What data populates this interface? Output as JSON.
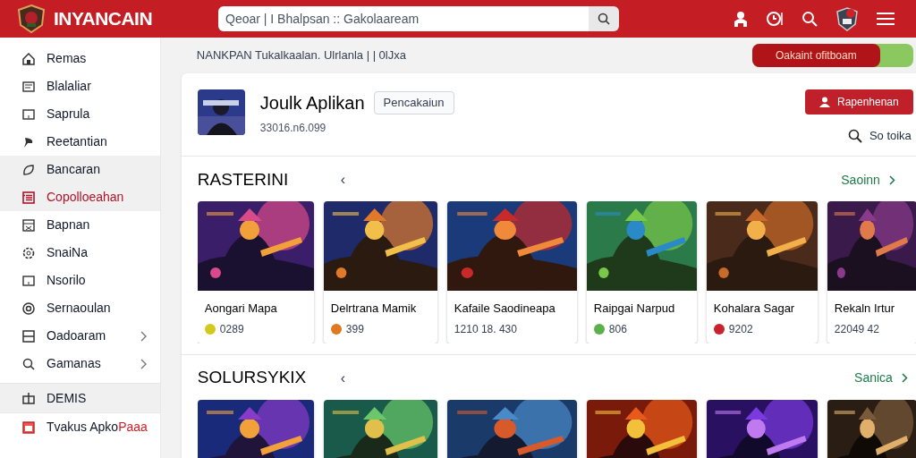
{
  "header": {
    "brand": "INYANCAIN",
    "search": {
      "placeholder": "Qeoar | I Bhalpsan :: Gakolaaream"
    }
  },
  "sidebar": {
    "items": [
      {
        "label": "Remas",
        "kind": "item",
        "selected": false,
        "highlighted": false
      },
      {
        "label": "Blalaliar",
        "kind": "item",
        "selected": false,
        "highlighted": false
      },
      {
        "label": "Saprula",
        "kind": "item",
        "selected": false,
        "highlighted": false
      },
      {
        "label": "Reetantian",
        "kind": "item",
        "selected": false,
        "highlighted": false
      },
      {
        "label": "Bancaran",
        "kind": "item",
        "selected": false,
        "highlighted": true
      },
      {
        "label": "Copolloeahan",
        "kind": "item",
        "selected": true,
        "highlighted": true
      },
      {
        "label": "Bapnan",
        "kind": "item",
        "selected": false,
        "highlighted": false
      },
      {
        "label": "SnaiNa",
        "kind": "item",
        "selected": false,
        "highlighted": false
      },
      {
        "label": "Nsorilo",
        "kind": "item",
        "selected": false,
        "highlighted": false
      },
      {
        "label": "Sernaoulan",
        "kind": "item",
        "selected": false,
        "highlighted": false
      },
      {
        "label": "Oadoaram",
        "kind": "submenu",
        "selected": false,
        "highlighted": false
      },
      {
        "label": "Gamanas",
        "kind": "submenu",
        "selected": false,
        "highlighted": false
      },
      {
        "label": "DEMIS",
        "kind": "header",
        "selected": false,
        "highlighted": true
      },
      {
        "label": "Tvakus Apko",
        "accent": "Paaa",
        "kind": "item",
        "selected": false,
        "highlighted": false
      }
    ]
  },
  "breadcrumb": "NANKPAN Tukalkaalan. Ulrlanla | | 0lJxa",
  "promo_button": "Oakaint ofitboam",
  "app": {
    "name": "Joulk Aplikan",
    "tag": "Pencakaiun",
    "meta": "33016.n6.099",
    "action": "Rapenhenan",
    "search_label": "So toika"
  },
  "sections": [
    {
      "title": "RASTERINI",
      "collapse": "‹",
      "more": "Saoinn",
      "cards": [
        {
          "name": "Aongari Mapa",
          "rating": "0289",
          "color": "#d4c81c"
        },
        {
          "name": "Delrtrana Mamik",
          "rating": "399",
          "color": "#e07a1f"
        },
        {
          "name": "Kafaile Saodineapa",
          "rating": "1210 18. 430"
        },
        {
          "name": "Raipgai Narpud",
          "rating": "806",
          "color": "#5bb04a"
        },
        {
          "name": "Kohalara Sagar",
          "rating": "9202",
          "color": "#c8232c"
        },
        {
          "name": "Rekaln Irtur",
          "rating": "22049 42"
        }
      ]
    },
    {
      "title": "SOLURSYKIX",
      "collapse": "‹",
      "more": "Sanica"
    }
  ]
}
